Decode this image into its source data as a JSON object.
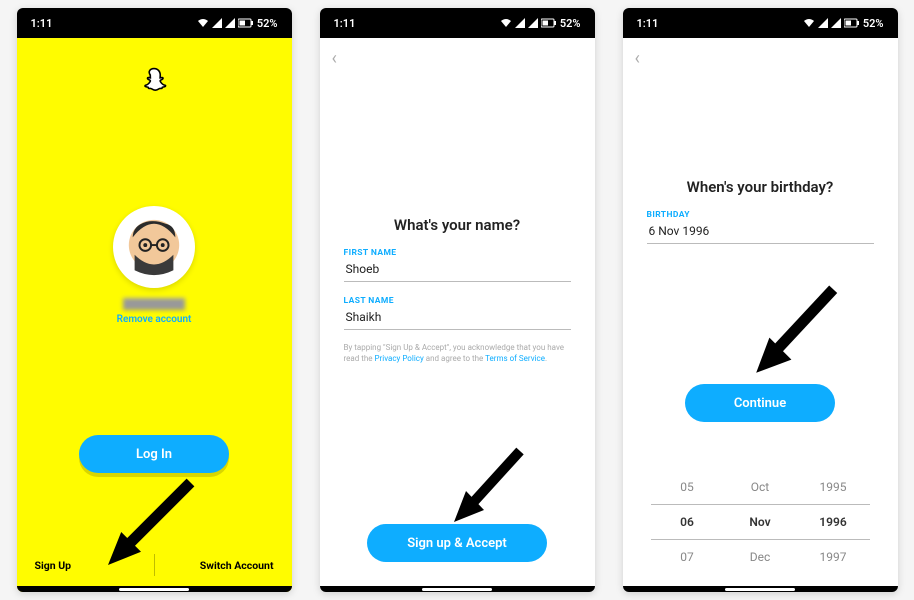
{
  "statusbar": {
    "time": "1:11",
    "battery": "52%"
  },
  "screen1": {
    "remove_account": "Remove account",
    "login_label": "Log In",
    "signup_label": "Sign Up",
    "switch_label": "Switch Account"
  },
  "screen2": {
    "headline": "What's your name?",
    "first_label": "FIRST NAME",
    "first_value": "Shoeb",
    "last_label": "LAST NAME",
    "last_value": "Shaikh",
    "legal_prefix": "By tapping \"Sign Up & Accept\", you acknowledge that you have read the ",
    "privacy": "Privacy Policy",
    "legal_mid": " and agree to the ",
    "tos": "Terms of Service",
    "legal_suffix": ".",
    "button": "Sign up & Accept"
  },
  "screen3": {
    "headline": "When's your birthday?",
    "label": "BIRTHDAY",
    "value": "6 Nov 1996",
    "button": "Continue",
    "picker": {
      "days": [
        "05",
        "06",
        "07"
      ],
      "months": [
        "Oct",
        "Nov",
        "Dec"
      ],
      "years": [
        "1995",
        "1996",
        "1997"
      ]
    }
  }
}
